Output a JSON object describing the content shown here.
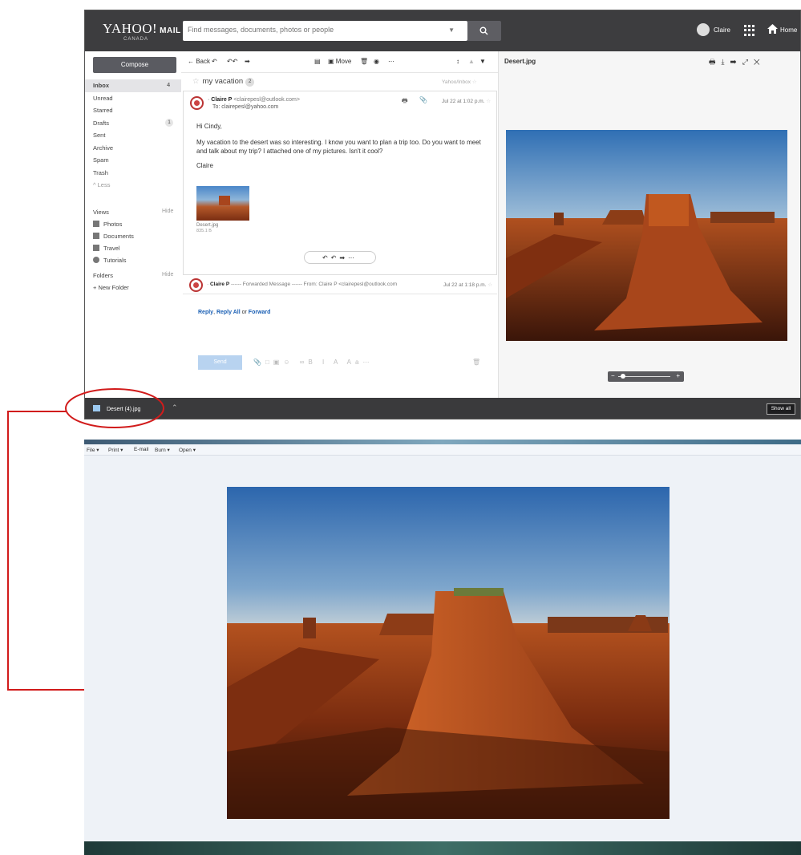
{
  "mail": {
    "logo": "YAHOO!",
    "logo_mail": "MAIL",
    "logo_sub": "CANADA",
    "search_placeholder": "Find messages, documents, photos or people",
    "user_name": "Claire",
    "home_label": "Home",
    "compose_label": "Compose",
    "folders": [
      {
        "label": "Inbox",
        "count": "4"
      },
      {
        "label": "Unread",
        "count": ""
      },
      {
        "label": "Starred",
        "count": ""
      },
      {
        "label": "Drafts",
        "count": "1"
      },
      {
        "label": "Sent",
        "count": ""
      },
      {
        "label": "Archive",
        "count": ""
      },
      {
        "label": "Spam",
        "count": ""
      },
      {
        "label": "Trash",
        "count": ""
      },
      {
        "label": "^ Less",
        "count": ""
      }
    ],
    "views_heading": "Views",
    "views_hide": "Hide",
    "views": [
      "Photos",
      "Documents",
      "Travel",
      "Tutorials"
    ],
    "folders_heading": "Folders",
    "folders_hide": "Hide",
    "new_folder": "+ New Folder",
    "toolbar": {
      "back": "← Back",
      "move": "Move"
    },
    "subject": "my vacation",
    "subject_count": "2",
    "folder_tag": "Yahoo/Inbox",
    "message": {
      "sender_name": "Claire P",
      "sender_email": "<clairepesl@outlook.com>",
      "to": "To: clairepesl@yahoo.com",
      "date": "Jul 22 at 1:02 p.m.",
      "greeting": "Hi Cindy,",
      "body": "My vacation to the desert was so interesting. I know you want to plan a trip too. Do you want to meet and talk about my trip? I attached one of my pictures. Isn't it cool?",
      "signoff": "Claire",
      "attachment_name": "Desert.jpg",
      "attachment_size": "835.1 B"
    },
    "forwarded": {
      "sender_name": "Claire P",
      "text": "------ Forwarded Message ------ From: Claire P <clairepesl@outlook.com",
      "date": "Jul 22 at 1:18 p.m."
    },
    "reply_links": {
      "reply": "Reply",
      "reply_all": "Reply All",
      "or": "or",
      "forward": "Forward"
    },
    "send_label": "Send",
    "preview_title": "Desert.jpg",
    "download_item": "Desert (4).jpg",
    "show_all": "Show all"
  },
  "viewer": {
    "menu": [
      "File ▾",
      "Print ▾",
      "E-mail",
      "Burn ▾",
      "Open ▾"
    ]
  },
  "colors": {
    "topbar": "#3d3d3f",
    "compose": "#5a5b61",
    "link_blue": "#1a5fb4",
    "annotation_red": "#d11b1b"
  },
  "icons": [
    "search-icon",
    "home-icon",
    "apps-icon",
    "print-icon",
    "download-icon",
    "close-icon",
    "reply-icon",
    "forward-icon"
  ]
}
